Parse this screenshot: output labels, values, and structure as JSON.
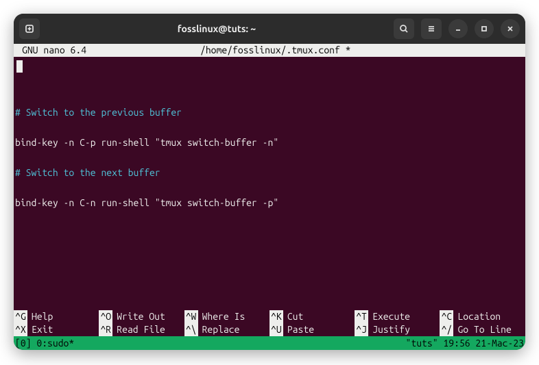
{
  "titlebar": {
    "title": "fosslinux@tuts: ~"
  },
  "nano": {
    "app": "GNU nano 6.4",
    "file": "/home/fosslinux/.tmux.conf *"
  },
  "editor": {
    "lines": {
      "c1": "# Switch to the previous buffer",
      "l1": "bind-key -n C-p run-shell \"tmux switch-buffer -n\"",
      "c2": "# Switch to the next buffer",
      "l2": "bind-key -n C-n run-shell \"tmux switch-buffer -p\""
    }
  },
  "hints": {
    "r1": [
      {
        "key": "^G",
        "label": "Help"
      },
      {
        "key": "^O",
        "label": "Write Out"
      },
      {
        "key": "^W",
        "label": "Where Is"
      },
      {
        "key": "^K",
        "label": "Cut"
      },
      {
        "key": "^T",
        "label": "Execute"
      },
      {
        "key": "^C",
        "label": "Location"
      }
    ],
    "r2": [
      {
        "key": "^X",
        "label": "Exit"
      },
      {
        "key": "^R",
        "label": "Read File"
      },
      {
        "key": "^\\",
        "label": "Replace"
      },
      {
        "key": "^U",
        "label": "Paste"
      },
      {
        "key": "^J",
        "label": "Justify"
      },
      {
        "key": "^/",
        "label": "Go To Line"
      }
    ]
  },
  "tmux": {
    "left": "[0] 0:sudo*",
    "right": "\"tuts\" 19:56 21-Mac-23"
  }
}
